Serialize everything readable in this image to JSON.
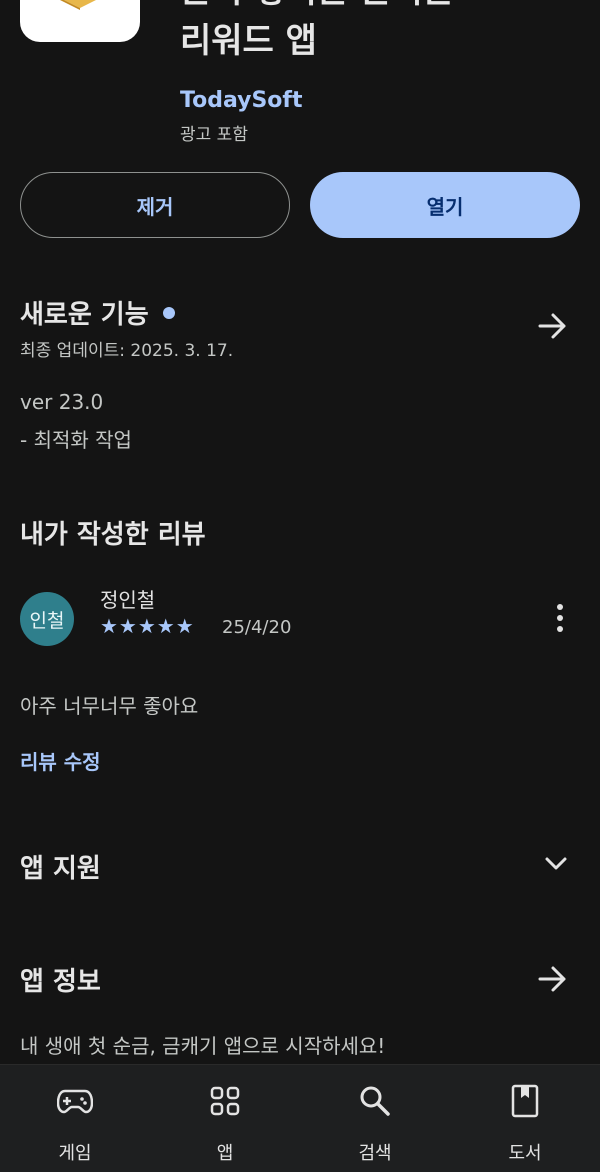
{
  "app": {
    "title": "돈이 쌓이는 손버는\n리워드 앱",
    "title_line1": "돈이 쌓이는 손버는",
    "title_line2": "리워드 앱",
    "developer": "TodaySoft",
    "ads_note": "광고 포함"
  },
  "actions": {
    "remove_label": "제거",
    "open_label": "열기"
  },
  "whats_new": {
    "title": "새로운 기능",
    "updated": "최종 업데이트: 2025. 3. 17.",
    "version": "ver 23.0",
    "note": "- 최적화 작업"
  },
  "my_review": {
    "title": "내가 작성한 리뷰",
    "avatar_text": "인철",
    "reviewer": "정인철",
    "rating": 5,
    "stars": "★★★★★",
    "date": "25/4/20",
    "text": "아주 너무너무 좋아요",
    "edit_label": "리뷰 수정"
  },
  "app_support": {
    "title": "앱 지원"
  },
  "app_info": {
    "title": "앱 정보",
    "description": "내 생애 첫 순금, 금캐기 앱으로 시작하세요!"
  },
  "bottom_nav": [
    {
      "label": "게임",
      "icon": "gamepad-icon"
    },
    {
      "label": "앱",
      "icon": "apps-grid-icon"
    },
    {
      "label": "검색",
      "icon": "search-icon"
    },
    {
      "label": "도서",
      "icon": "book-icon"
    }
  ],
  "colors": {
    "background": "#141414",
    "accent": "#a8c7fa",
    "open_button_text": "#062e6f",
    "avatar": "#2f7f8c"
  }
}
